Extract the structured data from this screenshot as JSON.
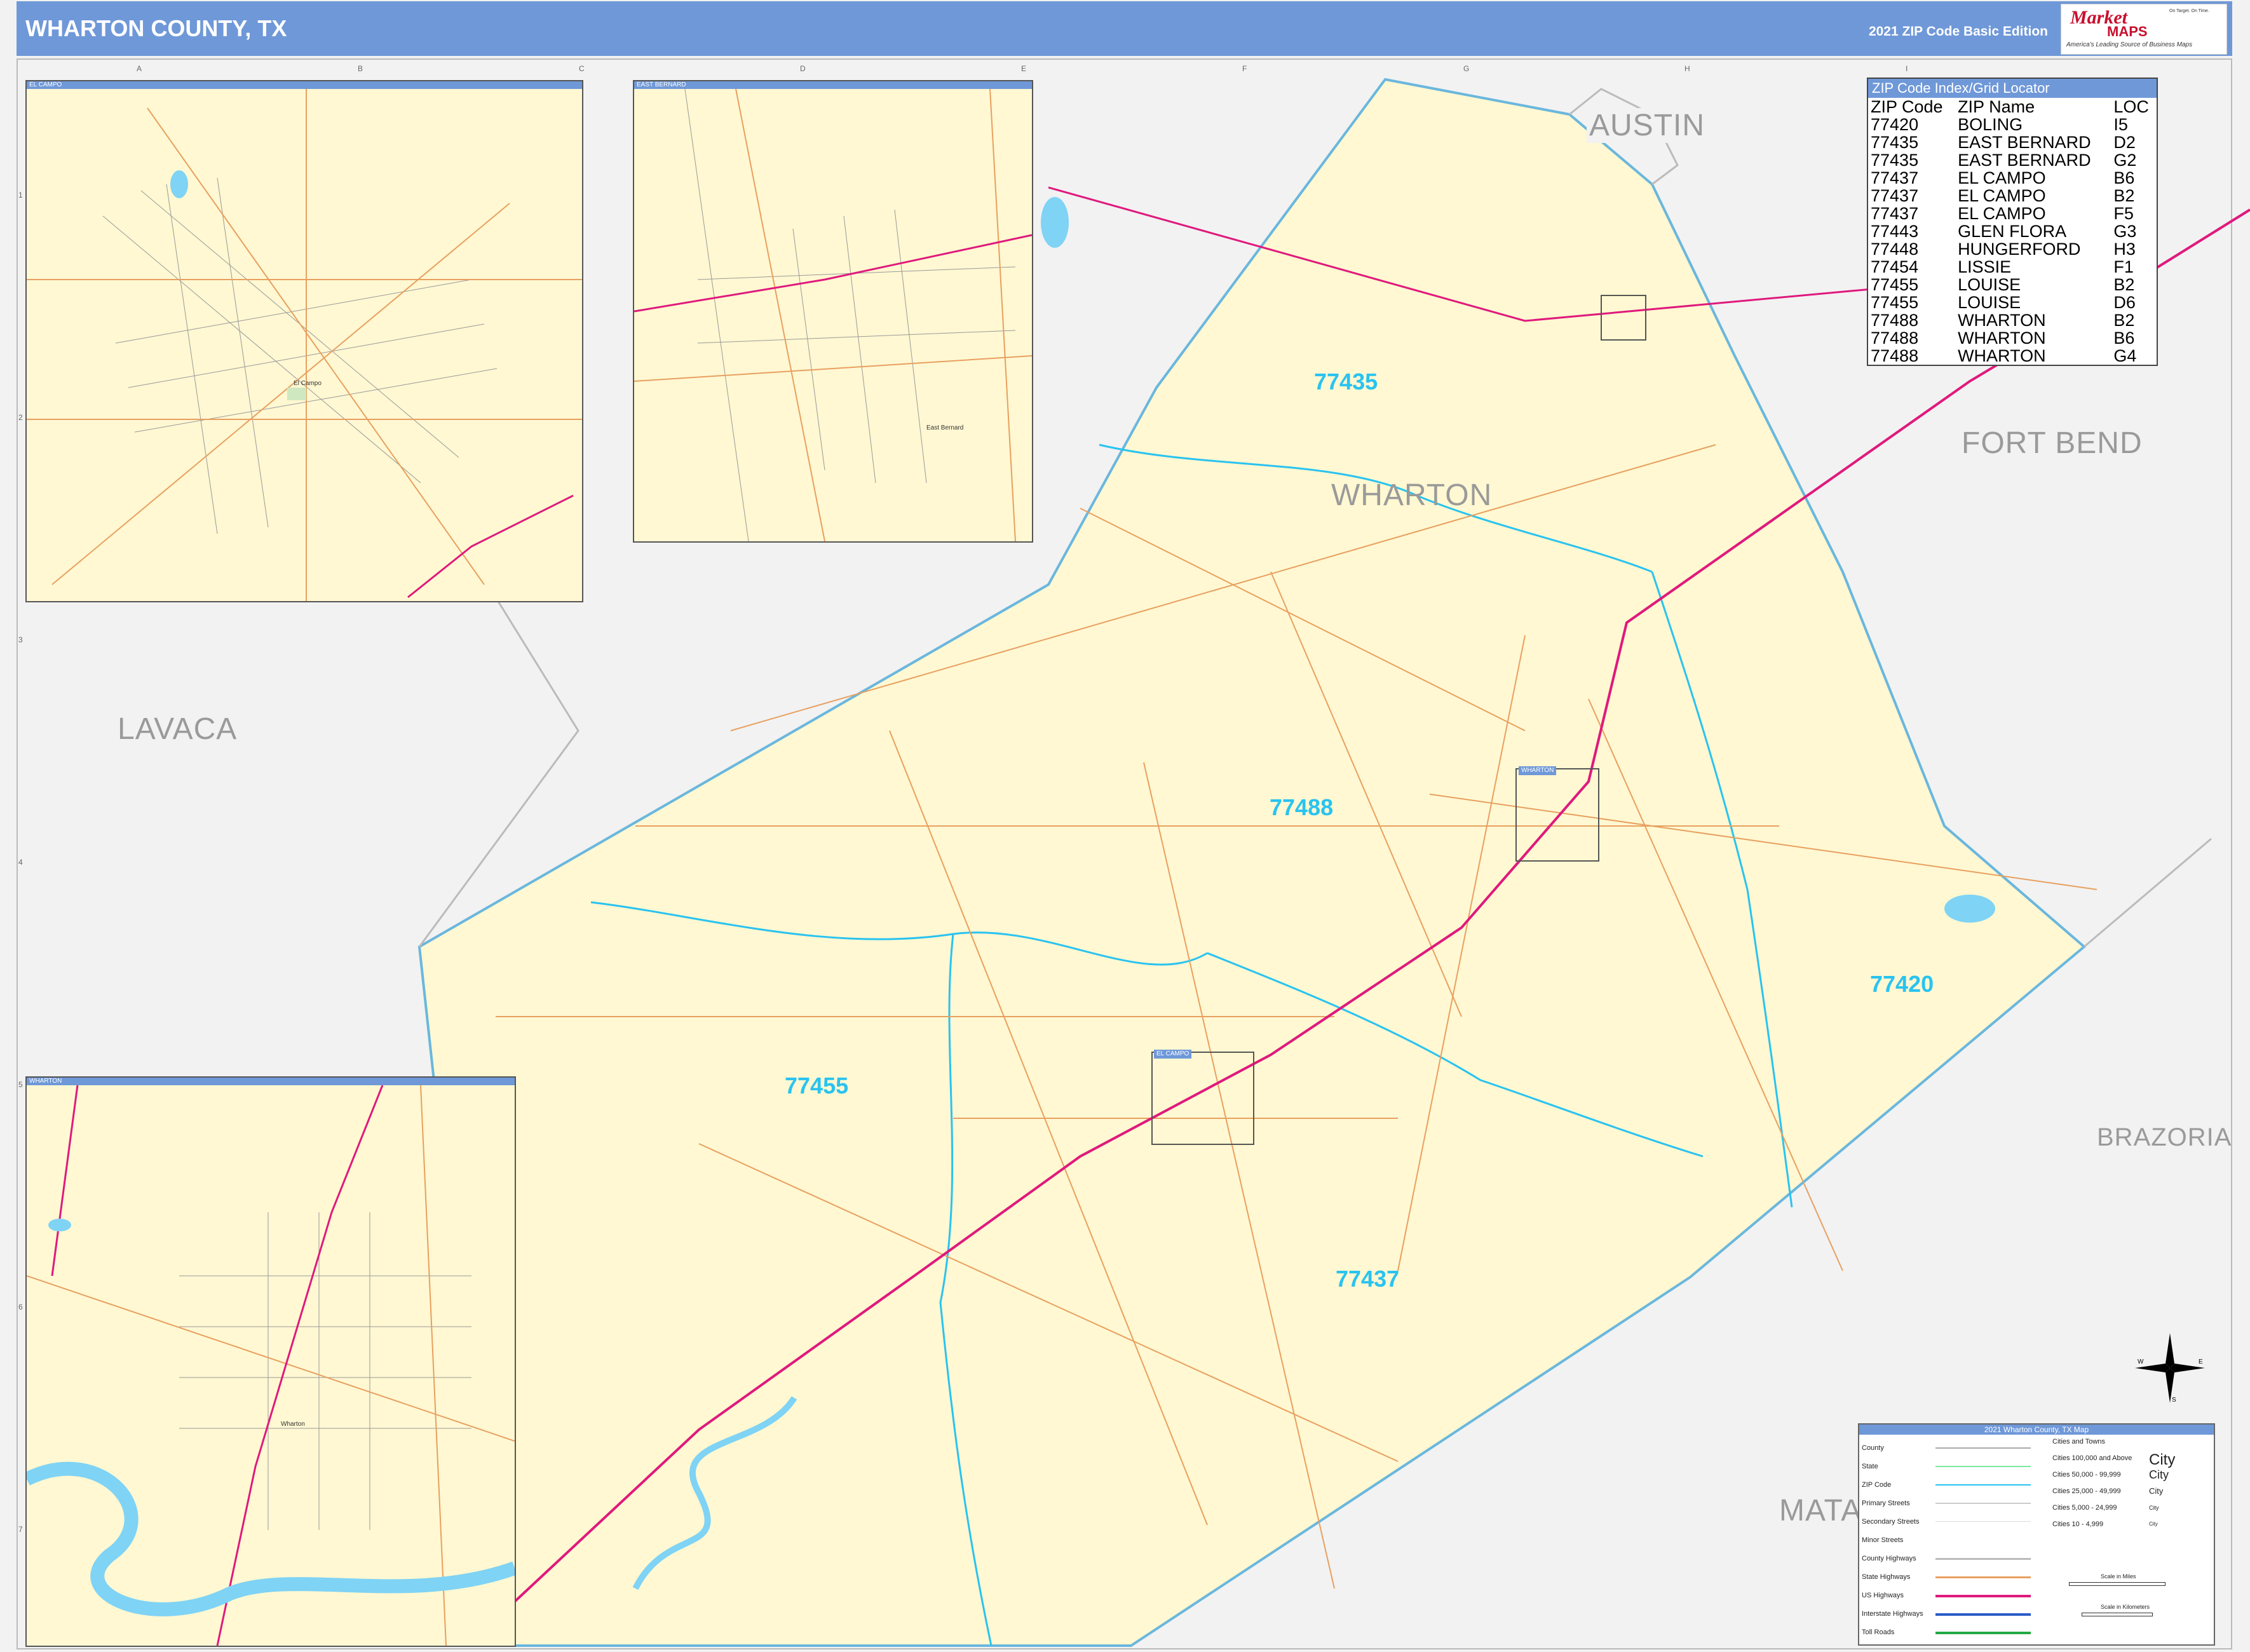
{
  "header": {
    "title": "WHARTON COUNTY, TX",
    "edition": "2021 ZIP Code Basic Edition",
    "logo_brand": "Market",
    "logo_maps": "MAPS",
    "logo_tagline": "America's Leading Source of Business Maps",
    "logo_slogan": "On Target. On Time."
  },
  "grid": {
    "columns": [
      "A",
      "B",
      "C",
      "D",
      "E",
      "F",
      "G",
      "H",
      "I"
    ],
    "rows": [
      "1",
      "2",
      "3",
      "4",
      "5",
      "6",
      "7"
    ]
  },
  "counties": {
    "austin": "AUSTIN",
    "fort_bend": "FORT BEND",
    "wharton": "WHARTON",
    "lavaca": "LAVACA",
    "brazoria": "BRAZORIA",
    "matagorda": "MATA"
  },
  "zip_labels": {
    "z77435": "77435",
    "z77488": "77488",
    "z77455": "77455",
    "z77437": "77437",
    "z77420": "77420"
  },
  "zip_index": {
    "title": "ZIP Code Index/Grid Locator",
    "columns": [
      "ZIP Code",
      "ZIP Name",
      "LOC"
    ],
    "rows": [
      [
        "77420",
        "BOLING",
        "I5"
      ],
      [
        "77435",
        "EAST BERNARD",
        "D2"
      ],
      [
        "77435",
        "EAST BERNARD",
        "G2"
      ],
      [
        "77437",
        "EL CAMPO",
        "B6"
      ],
      [
        "77437",
        "EL CAMPO",
        "B2"
      ],
      [
        "77437",
        "EL CAMPO",
        "F5"
      ],
      [
        "77443",
        "GLEN FLORA",
        "G3"
      ],
      [
        "77448",
        "HUNGERFORD",
        "H3"
      ],
      [
        "77454",
        "LISSIE",
        "F1"
      ],
      [
        "77455",
        "LOUISE",
        "B2"
      ],
      [
        "77455",
        "LOUISE",
        "D6"
      ],
      [
        "77488",
        "WHARTON",
        "B2"
      ],
      [
        "77488",
        "WHARTON",
        "B6"
      ],
      [
        "77488",
        "WHARTON",
        "G4"
      ]
    ]
  },
  "insets": {
    "el_campo": "EL CAMPO",
    "east_bernard": "EAST BERNARD",
    "wharton": "WHARTON",
    "el_campo_town": "El Campo",
    "east_bernard_town": "East Bernard",
    "wharton_town": "Wharton"
  },
  "legend": {
    "title": "2021 Wharton County, TX Map",
    "items": [
      "County",
      "State",
      "ZIP Code",
      "Primary Streets",
      "Secondary Streets",
      "Minor Streets",
      "County Highways",
      "State Highways",
      "US Highways",
      "Interstate Highways",
      "Toll Roads"
    ],
    "city_header": "Cities and Towns",
    "city_items": [
      "Cities 100,000 and Above",
      "Cities 50,000 - 99,999",
      "Cities 25,000 - 49,999",
      "Cities 5,000 - 24,999",
      "Cities 10 - 4,999"
    ],
    "city_samples": [
      "City",
      "City",
      "City",
      "City",
      "City"
    ],
    "scale_miles": "Scale in Miles",
    "scale_km": "Scale in Kilometers"
  },
  "compass": {
    "n": "N",
    "s": "S",
    "e": "E",
    "w": "W"
  },
  "colors": {
    "header": "#6f98d8",
    "county_fill": "#fff8d2",
    "zip_boundary": "#29c3f0",
    "us_highway": "#e0197d",
    "road": "#e8a060",
    "water": "#7fd3f5"
  }
}
